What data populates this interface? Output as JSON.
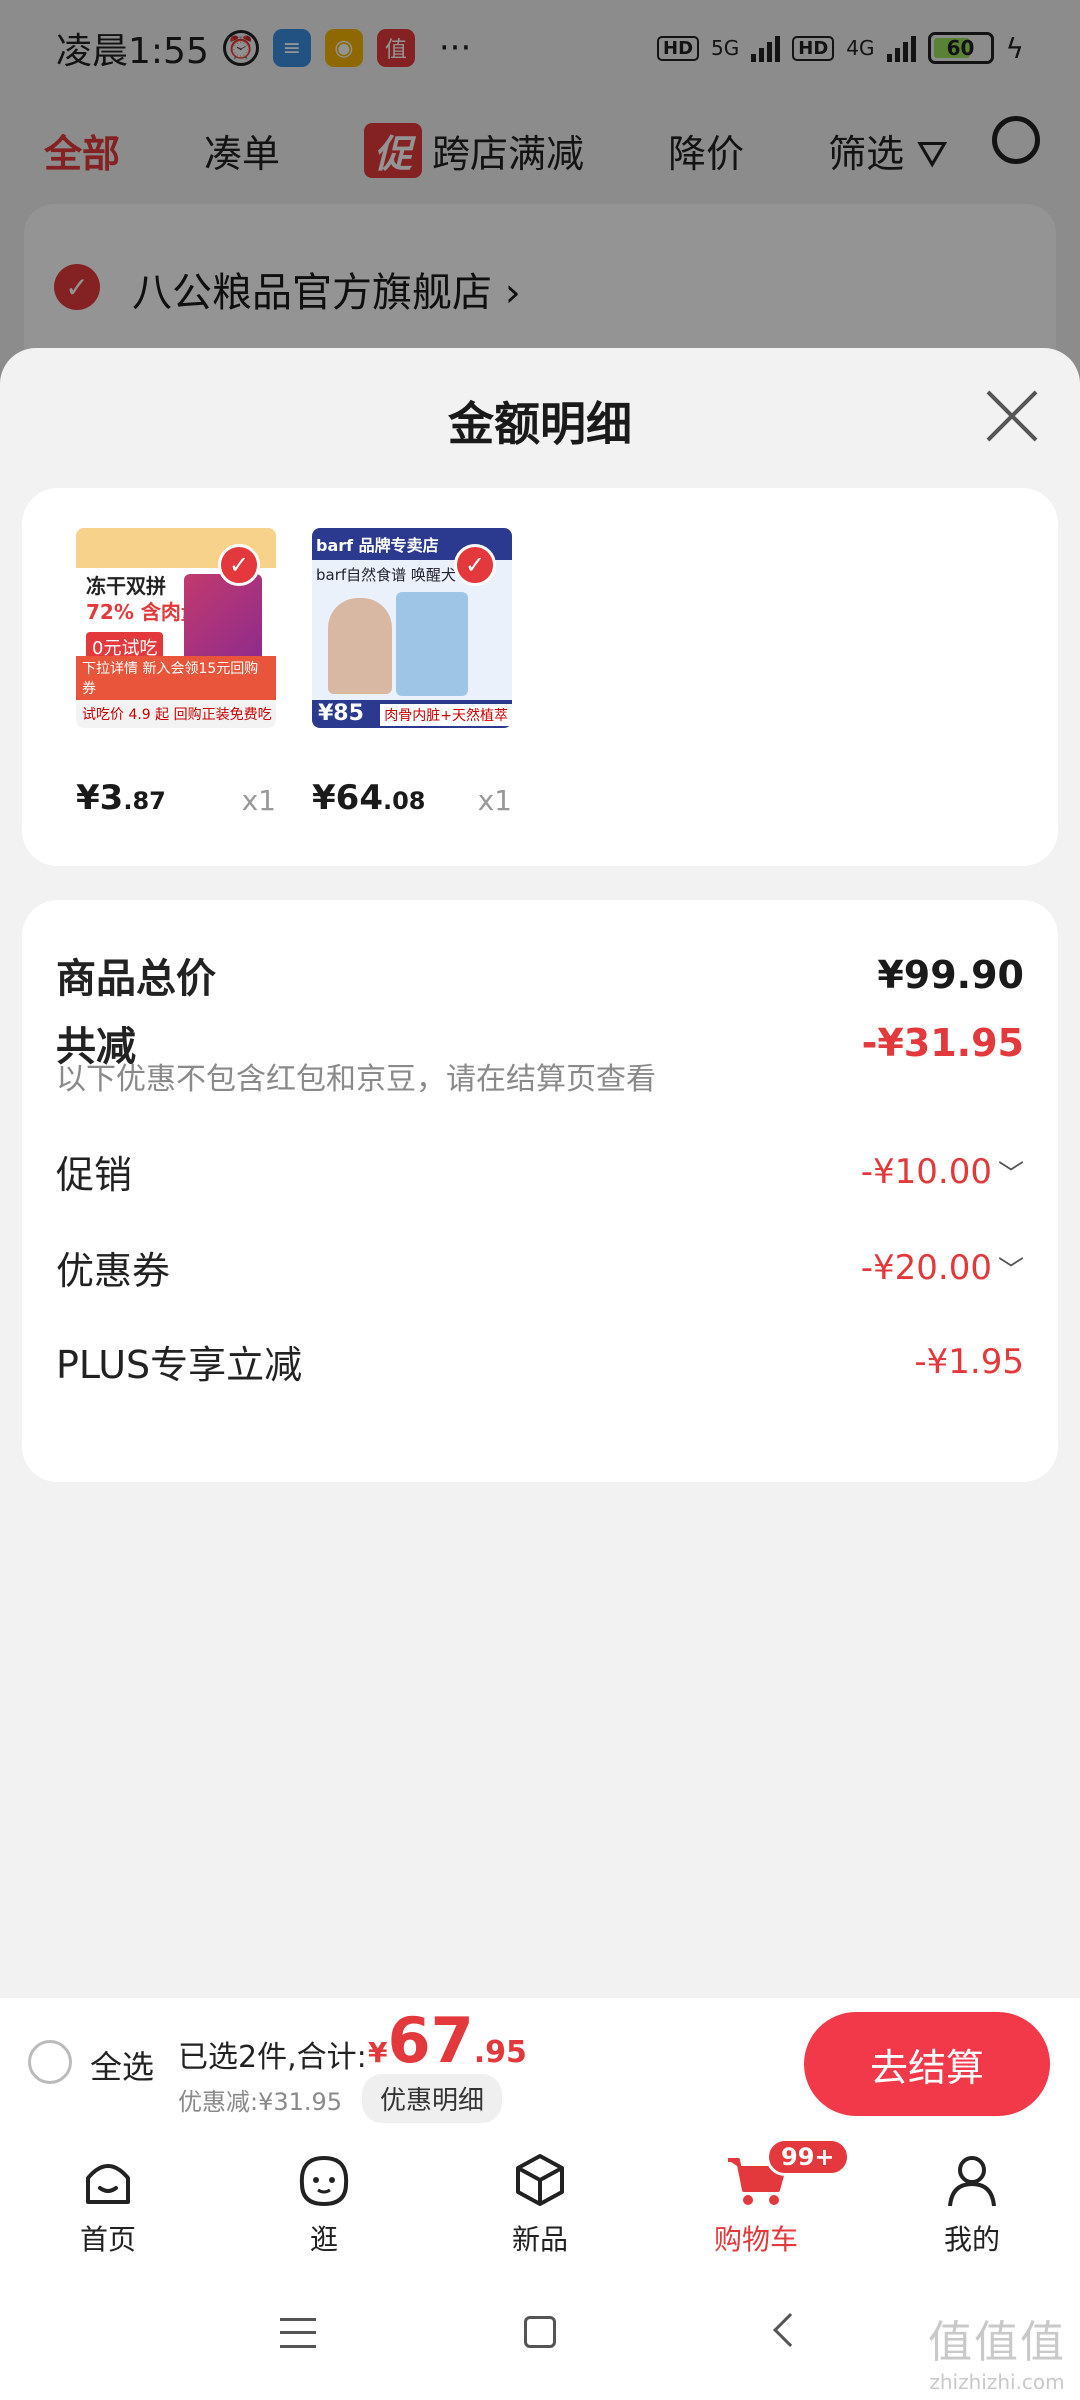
{
  "status_bar": {
    "time": "凌晨1:55",
    "more": "···",
    "network": [
      "HD",
      "5G",
      "HD",
      "4G"
    ],
    "battery": "60"
  },
  "behind": {
    "tabs": [
      "全部",
      "凑单",
      "跨店满减",
      "降价",
      "筛选"
    ],
    "promo_badge": "促",
    "shop_name": "八公粮品官方旗舰店 ›"
  },
  "sheet": {
    "title": "金额明细",
    "products": [
      {
        "price_int": "¥3",
        "price_dec": ".87",
        "qty": "x1",
        "thumb": {
          "line1": "冻干双拼",
          "line2": "72% 含肉量",
          "line3": "0元试吃",
          "line4": "下拉详情  新入会领15元回购券",
          "line5": "试吃价 4.9 起  回购正装免费吃"
        }
      },
      {
        "price_int": "¥64",
        "price_dec": ".08",
        "qty": "x1",
        "thumb": {
          "line1": "barf  品牌专卖店",
          "line2": "barf自然食谱 唤醒犬",
          "price": "¥85",
          "line3": "肉骨内脏+天然植萃"
        }
      }
    ],
    "summary": {
      "total_label": "商品总价",
      "total_value": "¥99.90",
      "reduce_label": "共减",
      "reduce_value": "-¥31.95",
      "note": "以下优惠不包含红包和京豆，请在结算页查看",
      "items": [
        {
          "label": "促销",
          "value": "-¥10.00",
          "expandable": true
        },
        {
          "label": "优惠券",
          "value": "-¥20.00",
          "expandable": true
        },
        {
          "label": "PLUS专享立减",
          "value": "-¥1.95",
          "expandable": false
        }
      ]
    }
  },
  "checkout": {
    "select_all": "全选",
    "selected": "已选2件,合计:",
    "total_yen": "¥",
    "total_int": "67",
    "total_dec": ".95",
    "discount": "优惠减:¥31.95",
    "detail_button": "优惠明细",
    "checkout_button": "去结算"
  },
  "tabbar": {
    "items": [
      {
        "label": "首页",
        "icon": "home-icon"
      },
      {
        "label": "逛",
        "icon": "browse-face-icon"
      },
      {
        "label": "新品",
        "icon": "box-icon"
      },
      {
        "label": "购物车",
        "icon": "cart-icon",
        "badge": "99+"
      },
      {
        "label": "我的",
        "icon": "person-icon"
      }
    ]
  },
  "watermark": {
    "line1": "值值值",
    "line2": "zhizhizhi.com"
  },
  "colors": {
    "accent": "#e4393c",
    "checkout": "#f2394a"
  }
}
